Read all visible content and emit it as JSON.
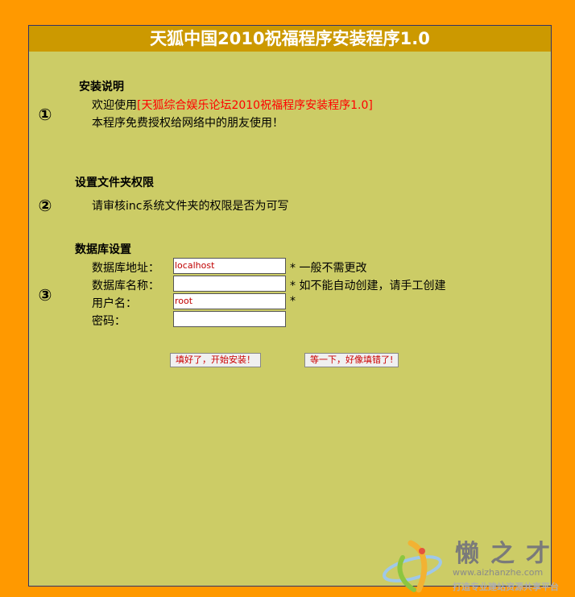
{
  "title": "天狐中国2010祝福程序安装程序1.0",
  "sections": [
    {
      "number": "①",
      "heading": "安装说明",
      "lines": {
        "welcome_prefix": "欢迎使用",
        "welcome_highlight": "[天狐综合娱乐论坛2010祝福程序安装程序1.0]",
        "license": "本程序免费授权给网络中的朋友使用！"
      }
    },
    {
      "number": "②",
      "heading": "设置文件夹权限",
      "text": "请审核inc系统文件夹的权限是否为可写"
    },
    {
      "number": "③",
      "heading": "数据库设置",
      "fields": [
        {
          "label": "数据库地址：",
          "value": "localhost",
          "hint": "* 一般不需更改"
        },
        {
          "label": "数据库名称：",
          "value": "",
          "hint": "* 如不能自动创建，请手工创建"
        },
        {
          "label": "用户名：",
          "value": "root",
          "hint": "*"
        },
        {
          "label": "密码：",
          "value": "",
          "hint": ""
        }
      ]
    }
  ],
  "buttons": {
    "submit": "填好了，开始安装！",
    "reset": "等一下，好像填错了!"
  },
  "watermark": {
    "name": "懒之才",
    "url": "www.aizhanzhe.com",
    "slogan": "打造专业建站资源共享平台"
  },
  "colors": {
    "background": "#FF9900",
    "panel": "#CCCC66",
    "titlebar": "#CC9900",
    "highlight": "#FF0000"
  }
}
